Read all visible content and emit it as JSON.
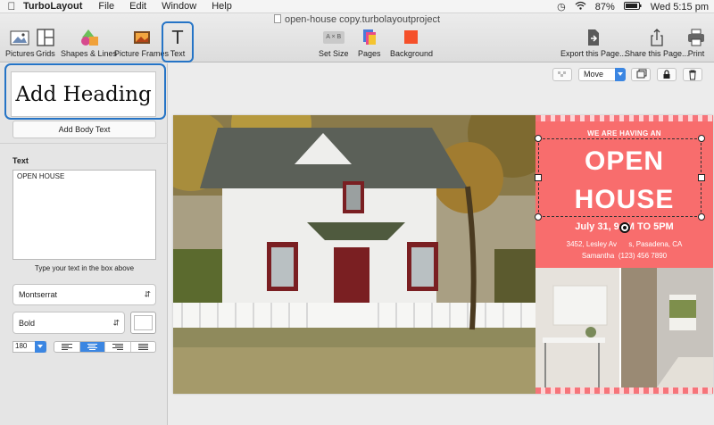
{
  "menu_bar": {
    "app_name": "TurboLayout",
    "items": [
      "File",
      "Edit",
      "Window",
      "Help"
    ],
    "battery": "87%",
    "clock": "Wed 5:15 pm"
  },
  "window": {
    "title": "open-house copy.turbolayoutproject"
  },
  "toolbar": {
    "pictures": "Pictures",
    "grids": "Grids",
    "shapes_lines": "Shapes & Lines",
    "picture_frames": "Picture Frames",
    "text": "Text",
    "set_size": "Set Size",
    "pages": "Pages",
    "background": "Background",
    "export": "Export this Page...",
    "share": "Share this Page...",
    "print": "Print",
    "set_size_icon_label": "A × B",
    "background_color": "#f5502a"
  },
  "left_panel": {
    "add_heading": "Add Heading",
    "add_body_text": "Add Body Text",
    "text_label": "Text",
    "text_value": "OPEN HOUSE",
    "hint": "Type your text in the box above",
    "font_family": "Montserrat",
    "font_weight": "Bold",
    "font_size": "180",
    "text_color": "#ffffff",
    "alignment_selected": "center"
  },
  "canvas_toolbar": {
    "mode": "Move"
  },
  "flyer": {
    "subtitle": "WE ARE HAVING AN",
    "headline_line1": "OPEN",
    "headline_line2": "HOUSE",
    "date": "July 31, 9AM TO 5PM",
    "address": "3452, Lesley Av      s, Pasadena, CA",
    "contact": "Samantha  (123) 456 7890",
    "accent_color": "#f86d6d"
  }
}
